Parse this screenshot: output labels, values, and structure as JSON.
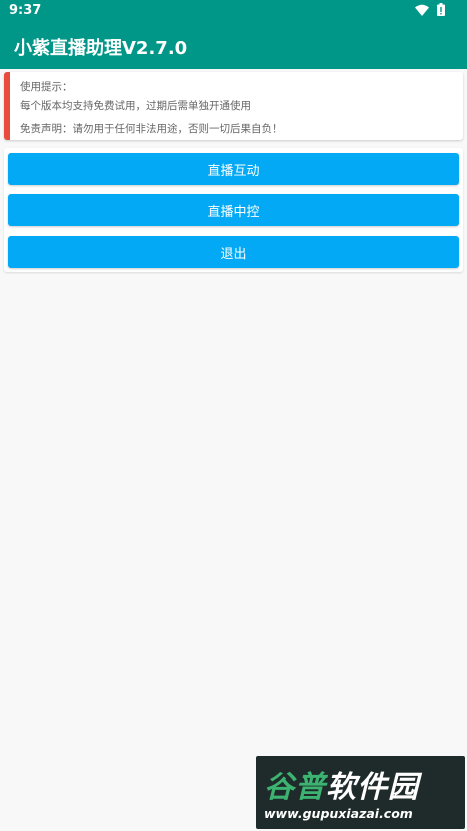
{
  "status_bar": {
    "time": "9:37",
    "icons": [
      "wifi-icon",
      "battery-icon"
    ]
  },
  "app_bar": {
    "title": "小紫直播助理V2.7.0"
  },
  "tips": {
    "heading": "使用提示：",
    "line1": "每个版本均支持免费试用，过期后需单独开通使用",
    "disclaimer": "免责声明：请勿用于任何非法用途，否则一切后果自负！"
  },
  "buttons": {
    "interact": "直播互动",
    "control": "直播中控",
    "exit": "退出"
  },
  "watermark": {
    "part1": "谷普",
    "part2": "软件园",
    "url": "www.gupuxiazai.com"
  },
  "colors": {
    "primary": "#009688",
    "button": "#03a9f4",
    "accent": "#e74c3c",
    "background": "#f8f8f8"
  }
}
